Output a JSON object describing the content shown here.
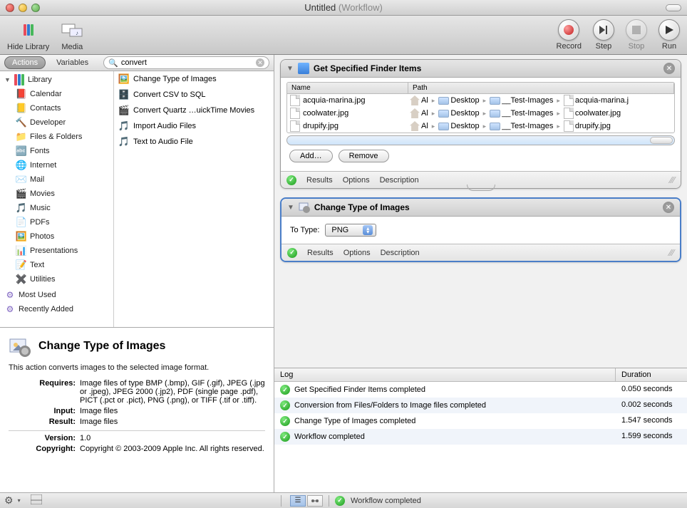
{
  "window": {
    "title": "Untitled",
    "subtitle": "(Workflow)"
  },
  "toolbar": {
    "hide_library": "Hide Library",
    "media": "Media",
    "record": "Record",
    "step": "Step",
    "stop": "Stop",
    "run": "Run"
  },
  "library_panel": {
    "tabs": {
      "actions": "Actions",
      "variables": "Variables"
    },
    "search": {
      "placeholder": "",
      "value": "convert"
    },
    "tree": {
      "root": "Library",
      "items": [
        "Calendar",
        "Contacts",
        "Developer",
        "Files & Folders",
        "Fonts",
        "Internet",
        "Mail",
        "Movies",
        "Music",
        "PDFs",
        "Photos",
        "Presentations",
        "Text",
        "Utilities"
      ],
      "extra": [
        "Most Used",
        "Recently Added"
      ]
    },
    "actions": [
      "Change Type of Images",
      "Convert CSV to SQL",
      "Convert Quartz …uickTime Movies",
      "Import Audio Files",
      "Text to Audio File"
    ]
  },
  "info": {
    "title": "Change Type of Images",
    "description": "This action converts images to the selected image format.",
    "requires_label": "Requires:",
    "requires": "Image files of type BMP (.bmp), GIF (.gif), JPEG (.jpg or .jpeg), JPEG 2000 (.jp2), PDF (single page .pdf), PICT (.pct or .pict), PNG (.png), or TIFF (.tif or .tiff).",
    "input_label": "Input:",
    "input": "Image files",
    "result_label": "Result:",
    "result": "Image files",
    "version_label": "Version:",
    "version": "1.0",
    "copyright_label": "Copyright:",
    "copyright": "Copyright © 2003-2009 Apple Inc.  All rights reserved."
  },
  "workflow": {
    "block1": {
      "title": "Get Specified Finder Items",
      "columns": {
        "name": "Name",
        "path": "Path"
      },
      "rows": [
        {
          "name": "acquia-marina.jpg",
          "path": [
            "Al",
            "Desktop",
            "__Test-Images",
            "acquia-marina.j"
          ]
        },
        {
          "name": "coolwater.jpg",
          "path": [
            "Al",
            "Desktop",
            "__Test-Images",
            "coolwater.jpg"
          ]
        },
        {
          "name": "drupify.jpg",
          "path": [
            "Al",
            "Desktop",
            "__Test-Images",
            "drupify.jpg"
          ]
        }
      ],
      "buttons": {
        "add": "Add…",
        "remove": "Remove"
      }
    },
    "block2": {
      "title": "Change Type of Images",
      "param_label": "To Type:",
      "param_value": "PNG"
    },
    "footer_tabs": {
      "results": "Results",
      "options": "Options",
      "description": "Description"
    }
  },
  "log": {
    "columns": {
      "log": "Log",
      "duration": "Duration"
    },
    "rows": [
      {
        "msg": "Get Specified Finder Items completed",
        "dur": "0.050 seconds"
      },
      {
        "msg": "Conversion from Files/Folders to Image files completed",
        "dur": "0.002 seconds"
      },
      {
        "msg": "Change Type of Images completed",
        "dur": "1.547 seconds"
      },
      {
        "msg": "Workflow completed",
        "dur": "1.599 seconds"
      }
    ]
  },
  "statusbar": {
    "msg": "Workflow completed"
  }
}
